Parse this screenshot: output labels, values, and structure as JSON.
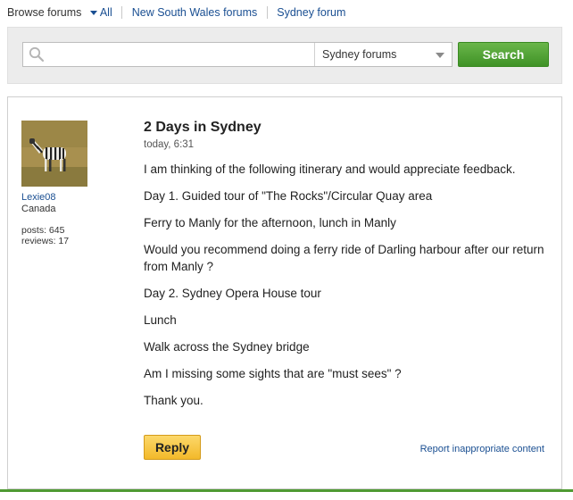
{
  "breadcrumb": {
    "browse_label": "Browse forums",
    "all_label": "All",
    "region_link": "New South Wales forums",
    "city_link": "Sydney forum"
  },
  "search": {
    "placeholder": "",
    "scope_selected": "Sydney forums",
    "button_label": "Search"
  },
  "post": {
    "author": {
      "username": "Lexie08",
      "location": "Canada",
      "posts": "posts: 645",
      "reviews": "reviews: 17"
    },
    "title": "2 Days in Sydney",
    "timestamp": "today, 6:31",
    "lines": [
      "I am thinking of the following itinerary and would appreciate feedback.",
      "Day 1. Guided tour of \"The Rocks\"/Circular Quay area",
      "Ferry to Manly for the afternoon, lunch in Manly",
      "Would you recommend doing a ferry ride of Darling harbour after our return from Manly ?",
      "Day 2. Sydney Opera House tour",
      "Lunch",
      "Walk across the Sydney bridge",
      "Am I missing some sights that are \"must sees\" ?",
      "Thank you."
    ],
    "reply_label": "Reply",
    "report_label": "Report inappropriate content"
  },
  "colors": {
    "link": "#1a4f92",
    "search_button": "#4ea332",
    "reply_button": "#f5c33a",
    "accent_line": "#4f9a33"
  }
}
